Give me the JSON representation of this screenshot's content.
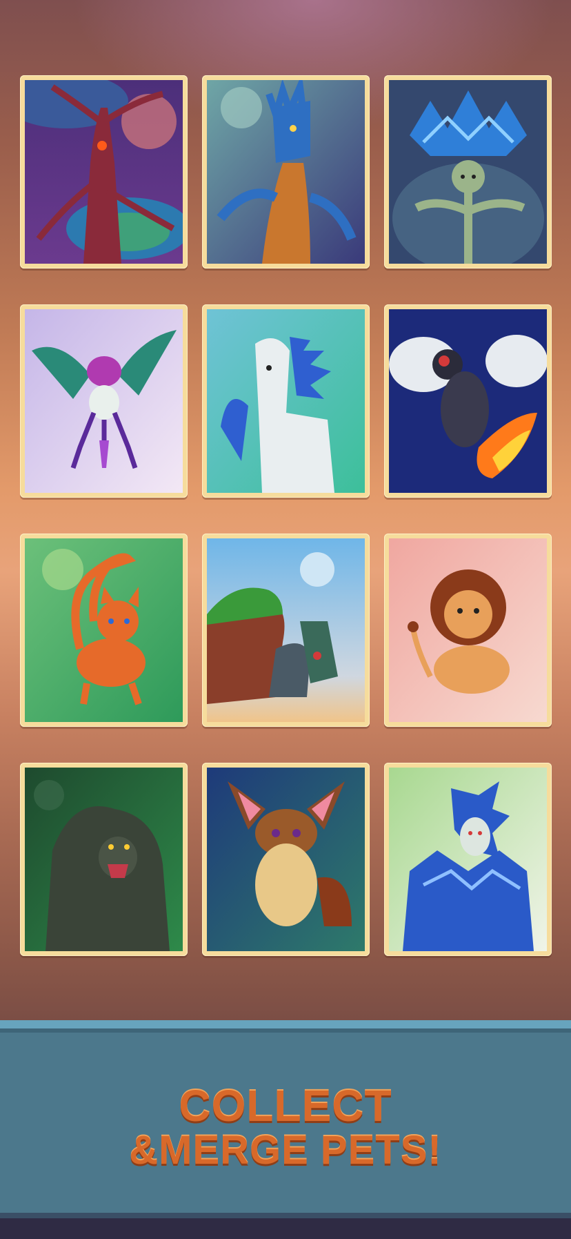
{
  "headline": {
    "line1": "COLLECT",
    "line2": "&MERGE PETS!"
  },
  "colors": {
    "banner": "#4c788c",
    "banner_highlight": "#67a4bd",
    "headline": "#d8692a",
    "card_frame": "#f6dc9c"
  },
  "pets": [
    {
      "icon": "tree-creature-icon"
    },
    {
      "icon": "water-dragon-icon"
    },
    {
      "icon": "lotus-sprite-icon"
    },
    {
      "icon": "hummingbird-pet-icon"
    },
    {
      "icon": "pegasus-horse-icon"
    },
    {
      "icon": "fire-beetle-icon"
    },
    {
      "icon": "orange-cat-icon"
    },
    {
      "icon": "rock-turtle-icon"
    },
    {
      "icon": "lion-cub-icon"
    },
    {
      "icon": "dark-beast-icon"
    },
    {
      "icon": "fennec-fox-icon"
    },
    {
      "icon": "armored-dragon-icon"
    }
  ]
}
